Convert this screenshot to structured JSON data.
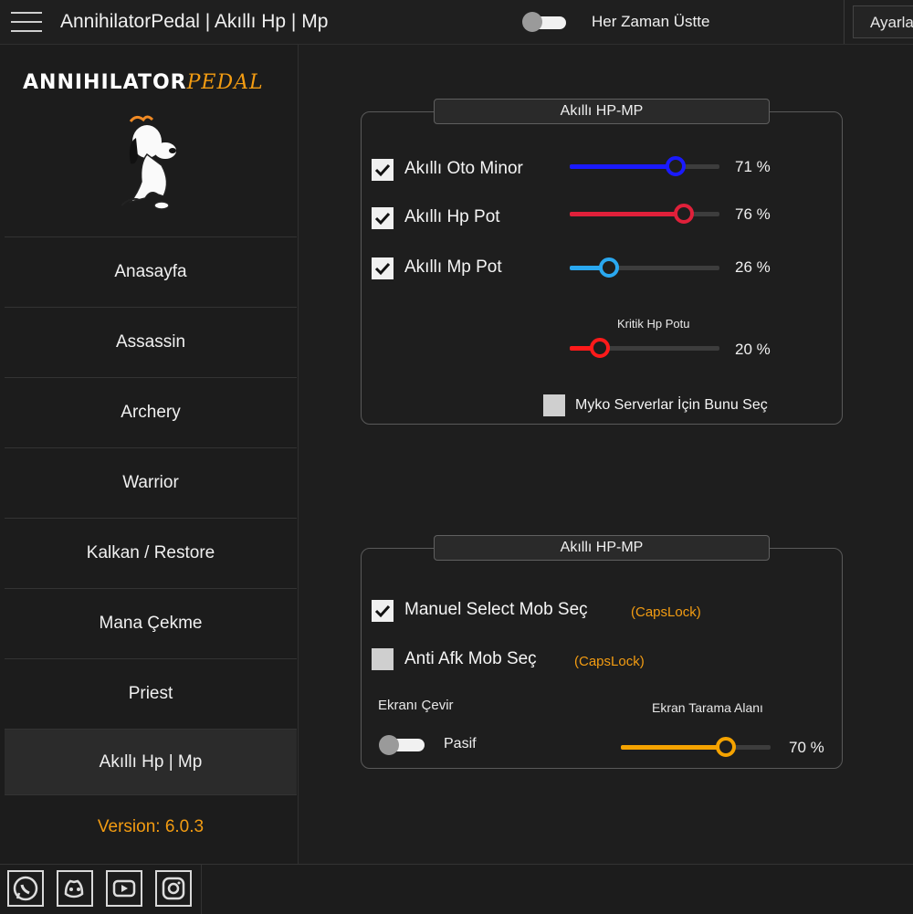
{
  "window": {
    "title": "AnnihilatorPedal | Akıllı Hp | Mp",
    "always_on_top_label": "Her Zaman Üstte",
    "always_on_top_on": false,
    "settings_label": "Ayarlar"
  },
  "sidebar": {
    "logo_main": "ANNIHILATOR",
    "logo_accent": "PEDAL",
    "items": [
      {
        "label": "Anasayfa"
      },
      {
        "label": "Assassin"
      },
      {
        "label": "Archery"
      },
      {
        "label": "Warrior"
      },
      {
        "label": "Kalkan / Restore"
      },
      {
        "label": "Mana Çekme"
      },
      {
        "label": "Priest"
      },
      {
        "label": "Akıllı Hp | Mp",
        "active": true
      }
    ],
    "version": "Version: 6.0.3"
  },
  "group1": {
    "title": "Akıllı HP-MP",
    "rows": [
      {
        "label": "Akıllı Oto Minor",
        "checked": true,
        "value": 71,
        "value_text": "71 %",
        "color": "#1a1aff"
      },
      {
        "label": "Akıllı Hp Pot",
        "checked": true,
        "value": 76,
        "value_text": "76 %",
        "color": "#e0203a"
      },
      {
        "label": "Akıllı Mp Pot",
        "checked": true,
        "value": 26,
        "value_text": "26 %",
        "color": "#2aa8f0"
      }
    ],
    "critical": {
      "label": "Kritik Hp Potu",
      "value": 20,
      "value_text": "20 %",
      "color": "#ff1a1a"
    },
    "myko": {
      "label": "Myko Serverlar İçin Bunu Seç",
      "checked": false
    }
  },
  "group2": {
    "title": "Akıllı HP-MP",
    "manual_select": {
      "label": "Manuel Select Mob Seç",
      "hint": "(CapsLock)",
      "checked": true
    },
    "anti_afk": {
      "label": "Anti Afk Mob Seç",
      "hint": "(CapsLock)",
      "checked": false
    },
    "flip_screen": {
      "label": "Ekranı Çevir",
      "state_label": "Pasif",
      "on": false
    },
    "scan_area": {
      "label": "Ekran Tarama Alanı",
      "value": 70,
      "value_text": "70 %",
      "color": "#f5a300"
    }
  },
  "social_icons": [
    "whatsapp-icon",
    "discord-icon",
    "youtube-icon",
    "instagram-icon"
  ]
}
